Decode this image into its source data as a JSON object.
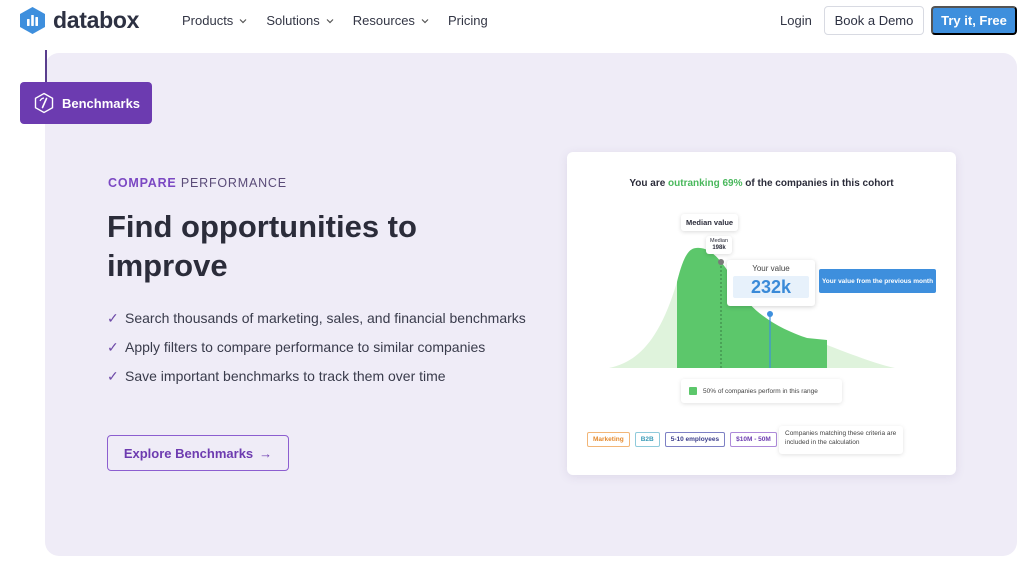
{
  "brand": {
    "name": "databox",
    "accent": "#3e8fdd",
    "purple": "#6c3bb0"
  },
  "nav": {
    "items": [
      {
        "label": "Products",
        "has_dropdown": true
      },
      {
        "label": "Solutions",
        "has_dropdown": true
      },
      {
        "label": "Resources",
        "has_dropdown": true
      },
      {
        "label": "Pricing",
        "has_dropdown": false
      }
    ],
    "login": "Login",
    "demo": "Book a Demo",
    "try": "Try it, Free"
  },
  "badge": {
    "label": "Benchmarks",
    "icon": "gauge-icon"
  },
  "hero": {
    "eyebrow_a": "COMPARE",
    "eyebrow_b": "PERFORMANCE",
    "headline": "Find opportunities to improve",
    "bullets": [
      "Search thousands of marketing, sales, and financial benchmarks",
      "Apply filters to compare performance to similar companies",
      "Save important benchmarks to track them over time"
    ],
    "cta": "Explore Benchmarks",
    "cta_arrow": "→"
  },
  "card": {
    "title_pre": "You are",
    "title_highlight": "outranking 69%",
    "title_post": "of the companies in this cohort",
    "median_label": "Median value",
    "median_small": "Median",
    "median_value": "198k",
    "your_value_label": "Your value",
    "your_value": "232k",
    "prev_month_tip": "Your value from the previous month",
    "range_text": "50% of companies perform in this range",
    "tags": [
      "Marketing",
      "B2B",
      "5-10 employees",
      "$10M - 50M"
    ],
    "criteria_text": "Companies matching these criteria are included in the calculation",
    "colors": {
      "green": "#5cc76b",
      "light_green": "#dff3dc",
      "blue": "#3e8fdd"
    }
  }
}
